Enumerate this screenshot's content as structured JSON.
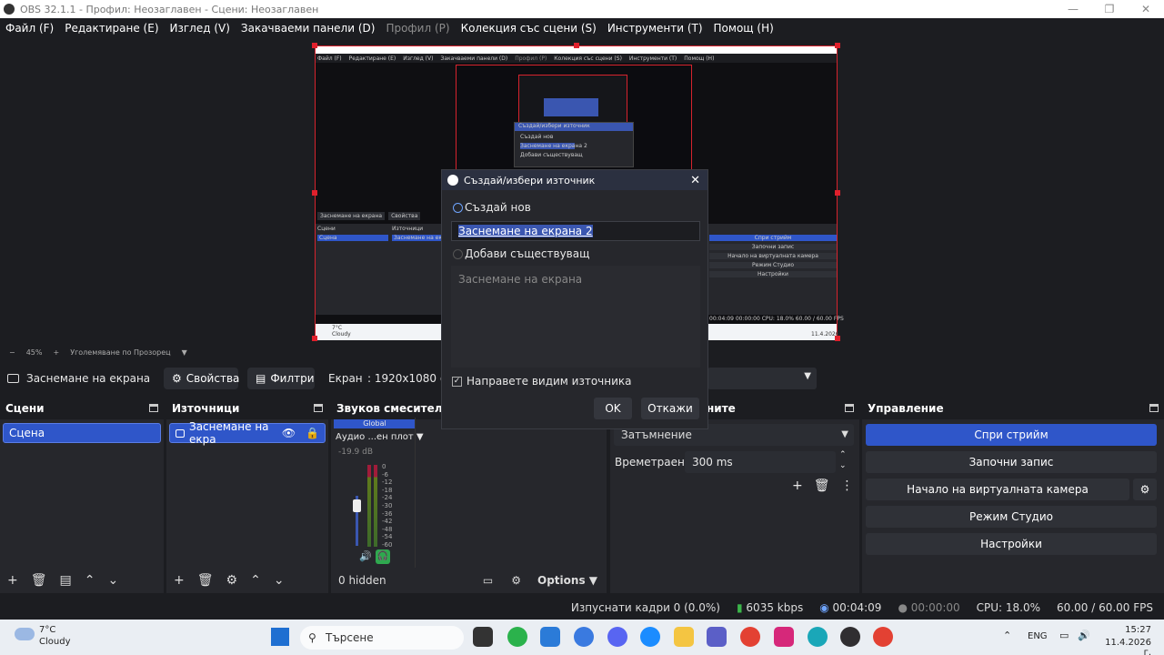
{
  "window": {
    "title": "OBS 32.1.1 - Профил: Неозаглавен - Сцени: Неозаглавен"
  },
  "menu": [
    "Файл (F)",
    "Редактиране (E)",
    "Изглед (V)",
    "Закачваеми панели (D)",
    "Профил (P)",
    "Колекция със сцени (S)",
    "Инструменти (T)",
    "Помощ (H)"
  ],
  "preview_ctl": {
    "minus": "−",
    "zoom": "45%",
    "plus": "+",
    "mode": "Уголемяване по Прозорец"
  },
  "context": {
    "source": "Заснемане на екрана",
    "properties": "Свойства",
    "filters": "Филтри",
    "screen_label": "Екран",
    "screen_value": ": 1920x1080 @ 0"
  },
  "scenes": {
    "title": "Сцени",
    "items": [
      "Сцена"
    ]
  },
  "sources": {
    "title": "Източници",
    "items": [
      "Заснемане на екра"
    ]
  },
  "mixer": {
    "title": "Звуков смесител",
    "global": "Global",
    "channel": "Аудио ...ен плот",
    "db": "-19.9 dB",
    "scale": [
      "0",
      "-6",
      "-12",
      "-18",
      "-24",
      "-30",
      "-36",
      "-42",
      "-48",
      "-54",
      "-60"
    ],
    "hidden": "0 hidden",
    "options": "Options"
  },
  "transitions": {
    "title": "ните",
    "type": "Затъмнение",
    "duration_label": "Времетраене",
    "duration_value": "300 ms"
  },
  "controls": {
    "title": "Управление",
    "buttons": [
      "Спри стрийм",
      "Започни запис",
      "Начало на виртуалната камера",
      "Режим Студио",
      "Настройки"
    ]
  },
  "dialog": {
    "title": "Създай/избери източник",
    "create_new": "Създай нов",
    "name_value": "Заснемане на екрана 2",
    "add_existing": "Добави съществуващ",
    "existing_items": [
      "Заснемане на екрана"
    ],
    "make_visible": "Направете видим източника",
    "ok": "OK",
    "cancel": "Откажи"
  },
  "status": {
    "dropped": "Изпуснати кадри 0 (0.0%)",
    "bitrate": "6035 kbps",
    "stream_time": "00:04:09",
    "rec_time": "00:00:00",
    "cpu": "CPU: 18.0%",
    "fps": "60.00 / 60.00 FPS"
  },
  "taskbar": {
    "temp": "7°C",
    "weather": "Cloudy",
    "search": "Търсене",
    "lang": "ENG",
    "time": "15:27",
    "date": "11.4.2026 г."
  },
  "nested": {
    "menu": [
      "Файл (F)",
      "Редактиране (E)",
      "Изглед (V)",
      "Закачваеми панели (D)",
      "Профил (P)",
      "Колекция със сцени (S)",
      "Инструменти (T)",
      "Помощ (H)"
    ],
    "scene_btn": "Заснемане на екрана",
    "props": "Свойства",
    "scenes": "Сцени",
    "sources": "Източници",
    "scene_item": "Сцена",
    "source_item": "Заснемане на екра",
    "controls": [
      "Спри стрийм",
      "Започни запис",
      "Начало на виртуалната камера",
      "Режим Студио",
      "Настройки"
    ],
    "temp": "7°C",
    "weather": "Cloudy",
    "status": "00:04:09   00:00:00   CPU: 18.0%   60.00 / 60.00 FPS",
    "date": "11.4.2026",
    "dlg_title": "Създай/избери източник",
    "dlg_new": "Създай нов",
    "dlg_name": "Заснемане на екрана 2",
    "dlg_existing": "Добави съществуващ"
  },
  "colors": {
    "accent": "#2f56c9",
    "selection_red": "#d6232d",
    "bg": "#1c1d21"
  }
}
